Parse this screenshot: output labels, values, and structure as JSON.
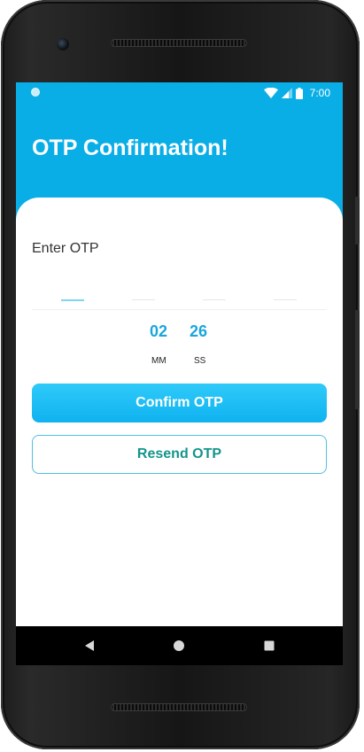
{
  "status_bar": {
    "time": "7:00",
    "icons": [
      "notification-dot-icon",
      "wifi-icon",
      "cellular-signal-icon",
      "battery-icon"
    ]
  },
  "header": {
    "title": "OTP Confirmation!",
    "background_color": "#0aaee6"
  },
  "otp": {
    "label": "Enter OTP",
    "digits": [
      "",
      "",
      "",
      ""
    ]
  },
  "timer": {
    "minutes": "02",
    "seconds": "26",
    "minutes_unit": "MM",
    "seconds_unit": "SS"
  },
  "actions": {
    "confirm_label": "Confirm OTP",
    "resend_label": "Resend OTP",
    "accent_color": "#0fb2f0",
    "resend_text_color": "#13948c"
  },
  "nav": {
    "icons": [
      "back-icon",
      "home-icon",
      "recents-icon"
    ]
  }
}
